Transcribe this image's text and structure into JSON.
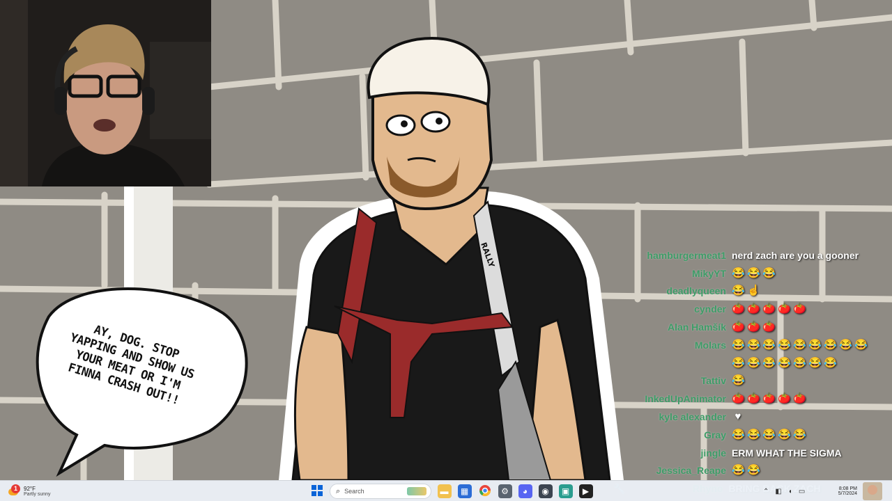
{
  "stream": {
    "speech_bubble_lines": [
      "AY, DOG. STOP",
      "YAPPING AND SHOW US",
      "YOUR MEAT OR I'M",
      "FINNA CRASH OUT!!"
    ],
    "logo_text": "RALLY"
  },
  "chat": {
    "messages": [
      {
        "user": "hamburgermeat1",
        "text": "nerd zach are you a gooner",
        "emotes": []
      },
      {
        "user": "MikyYT",
        "text": "",
        "emotes": [
          "laugh-emote",
          "laugh-emote",
          "laugh-emote"
        ]
      },
      {
        "user": "deadlyqueen",
        "text": "",
        "emotes": [
          "laugh-emote",
          "point-up-emote"
        ]
      },
      {
        "user": "cynder",
        "text": "",
        "emotes": [
          "tomato-emote",
          "tomato-emote",
          "tomato-emote",
          "tomato-emote",
          "tomato-emote"
        ]
      },
      {
        "user": "Alan Hamšík",
        "text": "",
        "emotes": [
          "tomato-emote",
          "tomato-emote",
          "tomato-emote"
        ]
      },
      {
        "user": "Molars",
        "text": "",
        "emotes": [
          "laugh-emote",
          "laugh-emote",
          "laugh-emote",
          "laugh-emote",
          "laugh-emote",
          "laugh-emote",
          "laugh-emote",
          "laugh-emote",
          "laugh-emote"
        ]
      },
      {
        "user": "",
        "text": "",
        "emotes": [
          "laugh-emote",
          "laugh-emote",
          "laugh-emote",
          "laugh-emote",
          "laugh-emote",
          "laugh-emote",
          "laugh-emote"
        ]
      },
      {
        "user": "Tattiv",
        "text": "",
        "emotes": [
          "laugh-emote"
        ]
      },
      {
        "user": "InkedUpAnimator",
        "text": "",
        "emotes": [
          "tomato-emote",
          "tomato-emote",
          "tomato-emote",
          "tomato-emote",
          "tomato-emote"
        ]
      },
      {
        "user": "kyle alexander",
        "text": "",
        "emotes": [
          "heart-emote"
        ]
      },
      {
        "user": "Gray",
        "text": "",
        "emotes": [
          "laugh-emote",
          "laugh-emote",
          "laugh-emote",
          "laugh-emote",
          "laugh-emote"
        ]
      },
      {
        "user": "jingle",
        "text": "ERM WHAT THE SIGMA",
        "emotes": []
      },
      {
        "user": "Jessica_Reape",
        "text": "",
        "emotes": [
          "laugh-emote",
          "laugh-emote"
        ]
      },
      {
        "user": "Rhyno",
        "text": "BRING BACK ZACH",
        "emotes": []
      }
    ],
    "user_color": "#3d9c67"
  },
  "taskbar": {
    "weather": {
      "temp": "92°F",
      "condition": "Partly sunny",
      "badge": "1"
    },
    "search_placeholder": "Search",
    "apps": [
      "start-icon",
      "search-icon",
      "file-explorer-icon",
      "store-icon",
      "chrome-icon",
      "settings-icon",
      "discord-icon",
      "webcam-app-icon",
      "obs-icon",
      "media-icon"
    ],
    "clock": {
      "time": "8:08 PM",
      "date": "5/7/2024"
    }
  }
}
